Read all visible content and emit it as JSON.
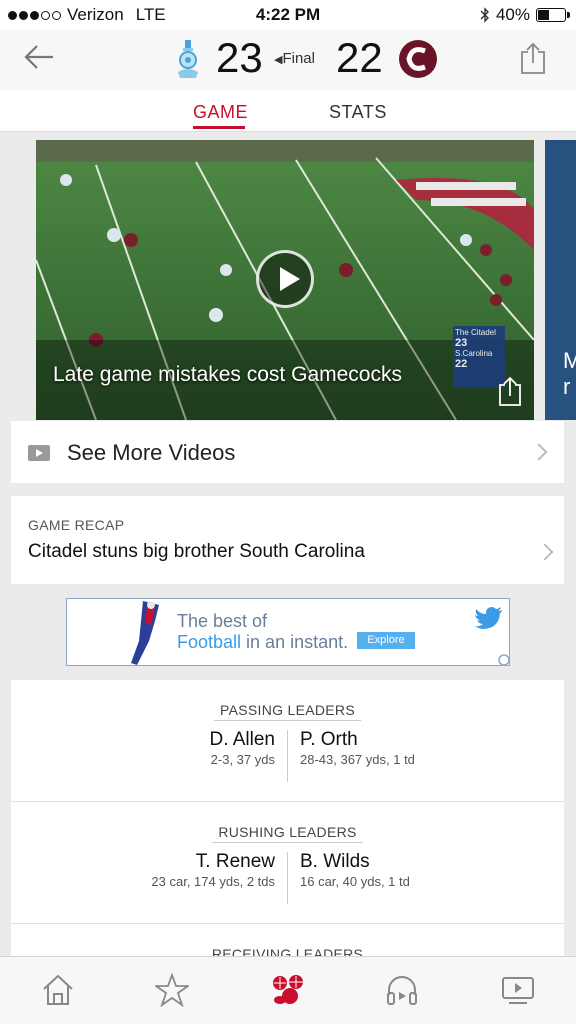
{
  "status_bar": {
    "carrier": "Verizon",
    "network": "LTE",
    "time": "4:22 PM",
    "battery": "40%",
    "battery_level": 0.4
  },
  "game_header": {
    "away_score": "23",
    "status": "Final",
    "home_score": "22"
  },
  "tabs": [
    {
      "label": "GAME",
      "active": true
    },
    {
      "label": "STATS",
      "active": false
    }
  ],
  "video": {
    "title": "Late game mistakes cost Gamecocks",
    "next_title_fragment": "M\nr",
    "score_bug": {
      "team1": "The Citadel",
      "score1": "23",
      "team2": "S.Carolina",
      "score2": "22"
    }
  },
  "see_more": {
    "label": "See More Videos"
  },
  "recap": {
    "kicker": "GAME RECAP",
    "headline": "Citadel stuns big brother South Carolina"
  },
  "ad": {
    "line1": "The best of",
    "line2_highlight": "Football",
    "line2_rest": " in an instant.",
    "cta": "Explore"
  },
  "leaders": [
    {
      "title": "PASSING LEADERS",
      "left_name": "D. Allen",
      "left_stats": "2-3, 37 yds",
      "right_name": "P. Orth",
      "right_stats": "28-43, 367 yds, 1 td"
    },
    {
      "title": "RUSHING LEADERS",
      "left_name": "T. Renew",
      "left_stats": "23 car, 174 yds, 2 tds",
      "right_name": "B. Wilds",
      "right_stats": "16 car, 40 yds, 1 td"
    },
    {
      "title": "RECEIVING LEADERS"
    }
  ],
  "colors": {
    "accent": "#c8102e",
    "home_team": "#6a1428",
    "twitter": "#3b9be5"
  },
  "tab_bar_icons": [
    "home-icon",
    "star-icon",
    "sports-balls-icon",
    "headphones-icon",
    "video-player-icon"
  ]
}
